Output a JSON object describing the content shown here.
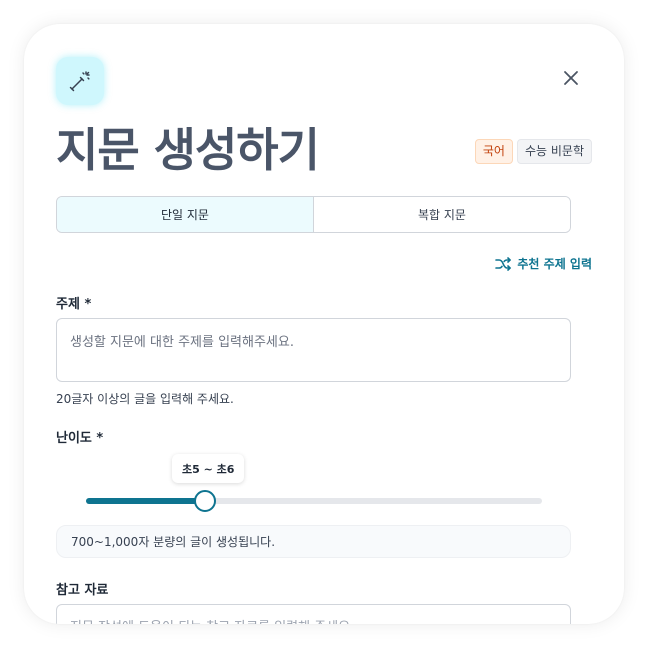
{
  "header": {
    "title": "지문 생성하기",
    "badges": [
      "국어",
      "수능 비문학"
    ]
  },
  "tabs": [
    {
      "label": "단일 지문",
      "active": true
    },
    {
      "label": "복합 지문",
      "active": false
    }
  ],
  "recommend": {
    "label": "추천 주제 입력",
    "icon": "shuffle-icon"
  },
  "topic": {
    "label": "주제 *",
    "placeholder": "생성할 지문에 대한 주제를 입력해주세요.",
    "helper": "20글자 이상의 글을 입력해 주세요."
  },
  "difficulty": {
    "label": "난이도 *",
    "selected": "초5 ~ 초6",
    "level_fraction": 0.26,
    "info": "700~1,000자 분량의 글이 생성됩니다."
  },
  "reference": {
    "label": "참고 자료",
    "placeholder": "지문 작성에 도움이 되는 참고 자료를 입력해 주세요."
  },
  "colors": {
    "accent": "#0e7490",
    "title": "#4a5568",
    "active_tab_bg": "#ecfbfe",
    "icon_bg": "#cff7fd"
  }
}
